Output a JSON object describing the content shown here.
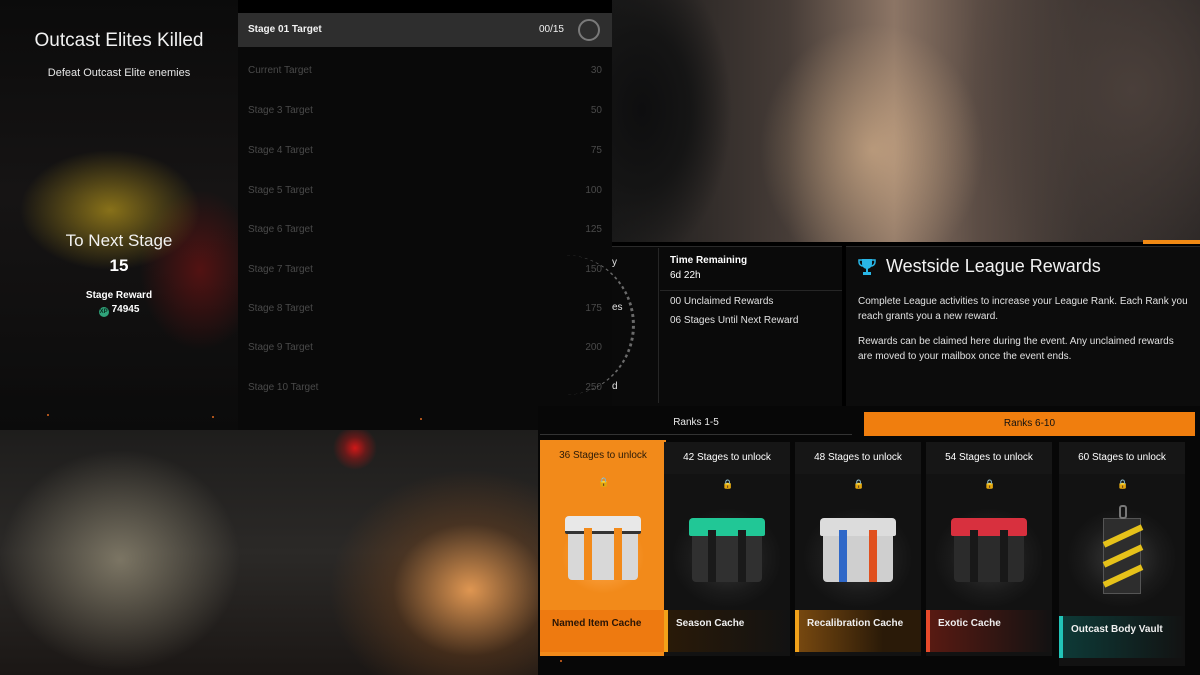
{
  "objective": {
    "title": "Outcast Elites Killed",
    "description": "Defeat Outcast Elite enemies",
    "to_next_label": "To Next Stage",
    "to_next_value": "15",
    "reward_label": "Stage Reward",
    "reward_value": "74945",
    "reward_icon": "xp-icon"
  },
  "stages": [
    {
      "label": "Stage 01 Target",
      "value": "00/15",
      "active": true
    },
    {
      "label": "Current Target",
      "value": "30"
    },
    {
      "label": "Stage 3 Target",
      "value": "50"
    },
    {
      "label": "Stage 4 Target",
      "value": "75"
    },
    {
      "label": "Stage 5 Target",
      "value": "100"
    },
    {
      "label": "Stage 6 Target",
      "value": "125"
    },
    {
      "label": "Stage 7 Target",
      "value": "150"
    },
    {
      "label": "Stage 8 Target",
      "value": "175"
    },
    {
      "label": "Stage 9 Target",
      "value": "200"
    },
    {
      "label": "Stage 10 Target",
      "value": "250"
    }
  ],
  "league_status": {
    "partial_y": "y",
    "partial_es": "es",
    "partial_d": "d",
    "time_label": "Time Remaining",
    "time_value": "6d 22h",
    "unclaimed": "00 Unclaimed Rewards",
    "stages_until": "06 Stages Until Next Reward"
  },
  "league_info": {
    "title": "Westside League Rewards",
    "icon": "trophy-icon",
    "paragraph1": "Complete League activities to increase your League Rank. Each Rank you reach grants you a new reward.",
    "paragraph2": "Rewards can be claimed here during the event. Any unclaimed rewards are moved to your mailbox once the event ends."
  },
  "tabs": [
    {
      "label": "Ranks 1-5",
      "active": false
    },
    {
      "label": "Ranks 6-10",
      "active": true
    }
  ],
  "rewards": [
    {
      "stages": "36 Stages to unlock",
      "name": "Named Item Cache",
      "selected": true,
      "color": "#f28a1a"
    },
    {
      "stages": "42 Stages to unlock",
      "name": "Season Cache",
      "color": "#f2a21a"
    },
    {
      "stages": "48 Stages to unlock",
      "name": "Recalibration Cache",
      "color": "#f2a21a"
    },
    {
      "stages": "54 Stages to unlock",
      "name": "Exotic Cache",
      "color": "#e84a2a"
    },
    {
      "stages": "60 Stages to unlock",
      "name": "Outcast Body Vault",
      "color": "#22c4b8"
    }
  ],
  "colors": {
    "accent": "#f28a14",
    "active_tab": "#f07e0e",
    "trophy": "#29b6e6"
  }
}
